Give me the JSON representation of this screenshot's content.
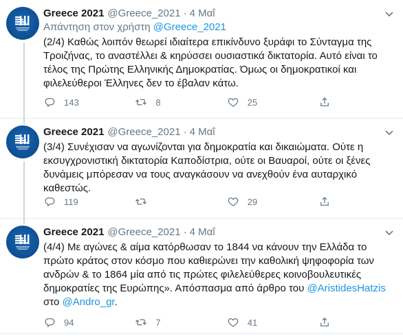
{
  "tweets": [
    {
      "author": "Greece 2021",
      "handle": "@Greece_2021",
      "separator": "·",
      "date": "4 Μαΐ",
      "reply_prefix": "Απάντηση στον χρήστη",
      "reply_handle": "@Greece_2021",
      "text": "(2/4) Καθώς λοιπόν θεωρεί ιδιαίτερα επικίνδυνο ξυράφι το Σύνταγμα της Τροιζήνας, το αναστέλλει & κηρύσσει ουσιαστικά δικτατορία. Αυτό είναι το τέλος της Πρώτης Ελληνικής Δημοκρατίας. Όμως οι δημοκρατικοί και φιλελεύθεροι Έλληνες δεν το έβαλαν κάτω.",
      "replies": "143",
      "retweets": "8",
      "likes": "25"
    },
    {
      "author": "Greece 2021",
      "handle": "@Greece_2021",
      "separator": "·",
      "date": "4 Μαΐ",
      "text": "(3/4) Συνέχισαν να αγωνίζονται για δημοκρατία και δικαιώματα. Ούτε η εκσυγχρονιστική δικτατορία Καποδίστρια, ούτε οι Βαυαροί, ούτε οι ξένες δυνάμεις μπόρεσαν να τους αναγκάσουν να ανεχθούν ένα αυταρχικό καθεστώς.",
      "replies": "119",
      "retweets": "",
      "likes": "29"
    },
    {
      "author": "Greece 2021",
      "handle": "@Greece_2021",
      "separator": "·",
      "date": "4 Μαΐ",
      "text_main": "(4/4) Με αγώνες & αίμα κατόρθωσαν το 1844 να κάνουν την Ελλάδα το πρώτο κράτος στον κόσμο που καθιερώνει την καθολική ψηφοφορία των ανδρών & το 1864 μία από τις πρώτες φιλελεύθερες κοινοβουλευτικές δημοκρατίες της Ευρώπης». Απόσπασμα από άρθρο του ",
      "mention1": "@AristidesHatzis",
      "text_mid": " στο ",
      "mention2": "@Andro_gr",
      "text_end": ".",
      "replies": "94",
      "retweets": "7",
      "likes": "41"
    }
  ],
  "icons": {
    "reply": "reply-icon",
    "retweet": "retweet-icon",
    "like": "heart-icon",
    "share": "share-icon",
    "caret": "chevron-down-icon"
  },
  "colors": {
    "link": "#1b95e0",
    "muted": "#657786",
    "text": "#14171a",
    "border": "#e6ecf0",
    "avatar_bg": "#0d4f93"
  }
}
